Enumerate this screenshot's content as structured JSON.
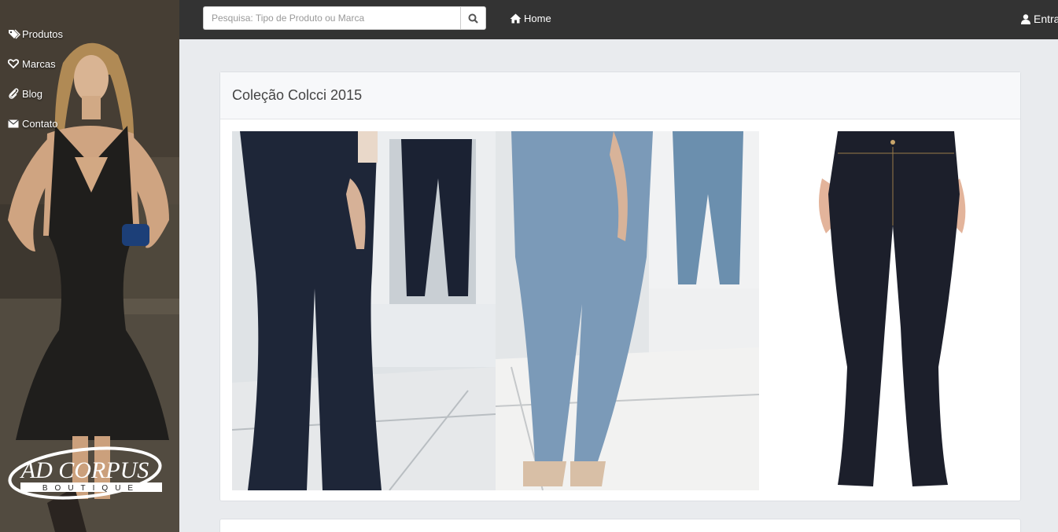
{
  "sidebar": {
    "items": [
      {
        "label": "Produtos",
        "icon": "tags-icon"
      },
      {
        "label": "Marcas",
        "icon": "heart-icon"
      },
      {
        "label": "Blog",
        "icon": "paperclip-icon"
      },
      {
        "label": "Contato",
        "icon": "envelope-icon"
      }
    ],
    "logo": {
      "main": "AD CORPUS",
      "sub": "BOUTIQUE"
    }
  },
  "topbar": {
    "search": {
      "placeholder": "Pesquisa: Tipo de Produto ou Marca",
      "value": ""
    },
    "home_label": "Home",
    "login_label": "Entrar"
  },
  "panel": {
    "title": "Coleção Colcci 2015"
  },
  "colors": {
    "topbar": "#333333",
    "page_bg": "#e9ebee",
    "panel_heading_bg": "#f7f8fa"
  }
}
